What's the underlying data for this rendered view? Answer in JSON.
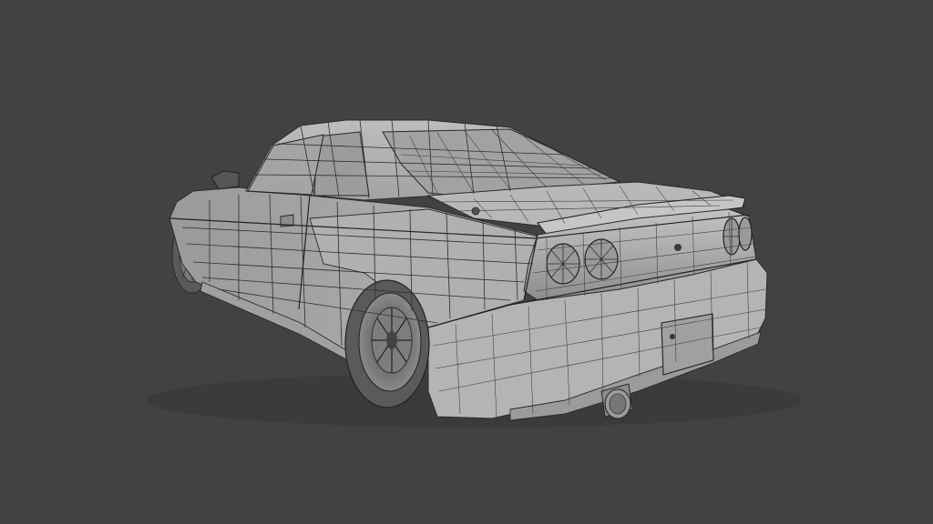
{
  "viewport": {
    "background_color": "#424242",
    "shading": "wireframe-overlay-solid",
    "subject": "car-model-rear-three-quarter"
  },
  "colors": {
    "body_base": "#a9a9a9",
    "body_light": "#c4c4c4",
    "body_dark": "#8a8a8a",
    "wire": "#2e2e2e",
    "glass": "#9e9e9e"
  }
}
